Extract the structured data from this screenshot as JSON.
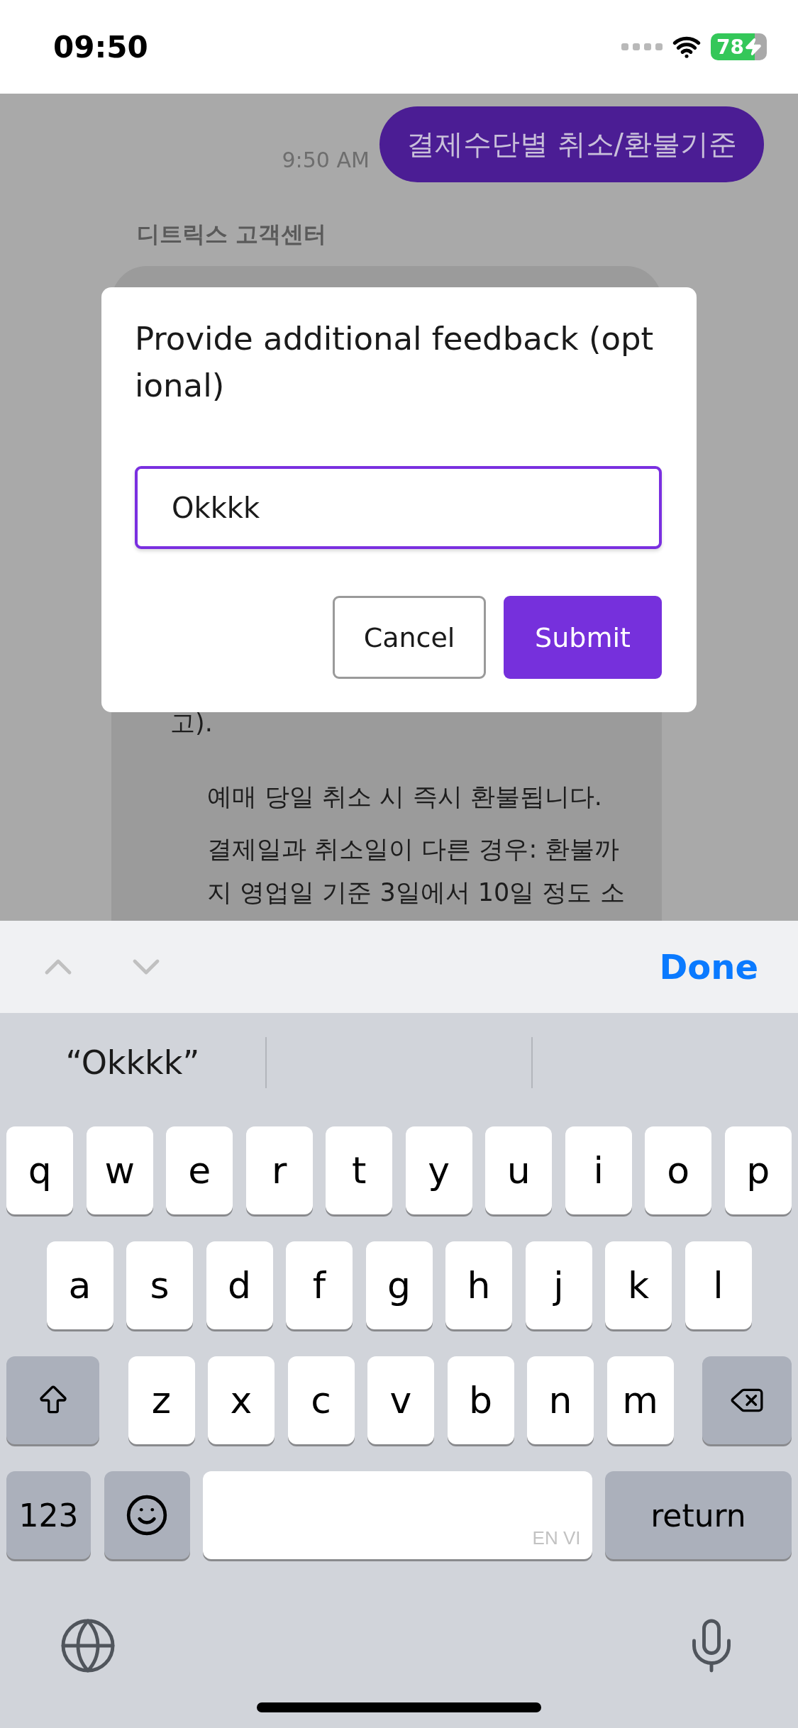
{
  "status_bar": {
    "time": "09:50",
    "battery": "78",
    "charging": true
  },
  "chat": {
    "outgoing": {
      "text": "결제수단별 취소/환불기준",
      "time": "9:50 AM"
    },
    "incoming": {
      "sender": "디트릭스 고객센터",
      "paragraphs": [
        {
          "kind": "plain",
          "text": "고)."
        },
        {
          "kind": "indented",
          "text": "예매 당일 취소 시 즉시 환불됩니다."
        },
        {
          "kind": "indented",
          "text": "결제일과 취소일이 다른 경우: 환불까지 영업일 기준 3일에서 10일 정도 소"
        }
      ]
    }
  },
  "dialog": {
    "title": "Provide additional feedback (optional)",
    "input": {
      "value": "Okkkk",
      "focused": true
    },
    "buttons": [
      {
        "label": "Cancel",
        "kind": "secondary"
      },
      {
        "label": "Submit",
        "kind": "primary"
      }
    ]
  },
  "keyboard_toolbar": {
    "done": "Done"
  },
  "suggestions": [
    "“Okkkk”"
  ],
  "keyboard": {
    "rows": [
      [
        "q",
        "w",
        "e",
        "r",
        "t",
        "y",
        "u",
        "i",
        "o",
        "p"
      ],
      [
        "a",
        "s",
        "d",
        "f",
        "g",
        "h",
        "j",
        "k",
        "l"
      ],
      [
        "z",
        "x",
        "c",
        "v",
        "b",
        "n",
        "m"
      ]
    ],
    "numbers_key": "123",
    "space_languages": "EN VI",
    "return_key": "return"
  }
}
